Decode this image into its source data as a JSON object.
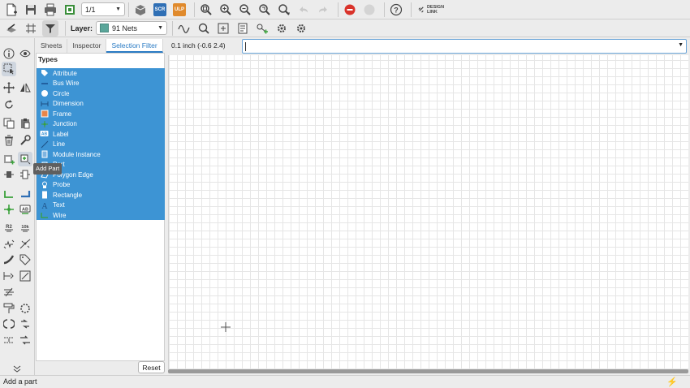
{
  "toolbar": {
    "sheet_value": "1/1",
    "scr_label": "SCR",
    "ulp_label": "ULP",
    "design_link_label_1": "DESIGN",
    "design_link_label_2": "LINK"
  },
  "layer_bar": {
    "layer_label": "Layer:",
    "layer_value": "91 Nets",
    "layer_color": "#5aa69a"
  },
  "panel": {
    "tabs": [
      {
        "label": "Sheets"
      },
      {
        "label": "Inspector"
      },
      {
        "label": "Selection Filter"
      }
    ],
    "types_title": "Types",
    "types": [
      {
        "label": "Attribute",
        "icon": "tag-icon"
      },
      {
        "label": "Bus Wire",
        "icon": "bus-icon"
      },
      {
        "label": "Circle",
        "icon": "circle-icon"
      },
      {
        "label": "Dimension",
        "icon": "dimension-icon"
      },
      {
        "label": "Frame",
        "icon": "frame-icon"
      },
      {
        "label": "Junction",
        "icon": "junction-icon"
      },
      {
        "label": "Label",
        "icon": "label-icon"
      },
      {
        "label": "Line",
        "icon": "line-icon"
      },
      {
        "label": "Module Instance",
        "icon": "module-icon"
      },
      {
        "label": "Part",
        "icon": "part-icon"
      },
      {
        "label": "Polygon Edge",
        "icon": "polygon-icon"
      },
      {
        "label": "Probe",
        "icon": "probe-icon"
      },
      {
        "label": "Rectangle",
        "icon": "rectangle-icon"
      },
      {
        "label": "Text",
        "icon": "text-icon"
      },
      {
        "label": "Wire",
        "icon": "wire-icon"
      }
    ],
    "reset_label": "Reset",
    "selection_color": "#3d94d4"
  },
  "tooltip": "Add Part",
  "command": {
    "coords": "0.1 inch (-0.6 2.4)",
    "value": ""
  },
  "status": {
    "text": "Add a part"
  }
}
